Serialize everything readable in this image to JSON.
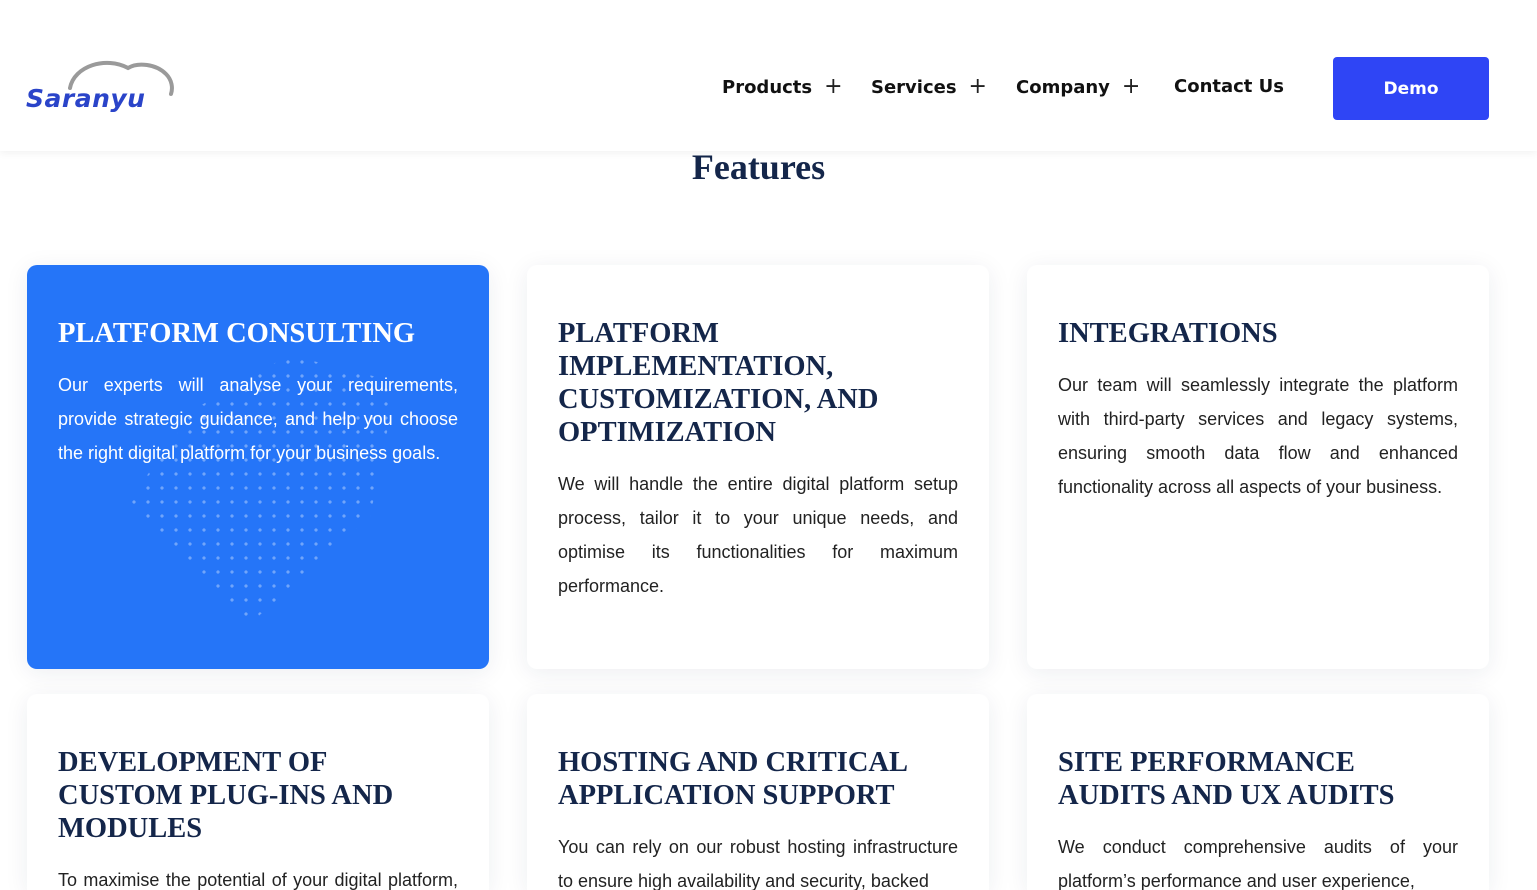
{
  "brand": {
    "name": "Saranyu",
    "accent": "#2f45f5",
    "card_active": "#2575f8",
    "heading_color": "#14264a"
  },
  "nav": {
    "items": [
      {
        "label": "Products",
        "has_submenu": true,
        "icon": "plus-icon"
      },
      {
        "label": "Services",
        "has_submenu": true,
        "icon": "plus-icon"
      },
      {
        "label": "Company",
        "has_submenu": true,
        "icon": "plus-icon"
      },
      {
        "label": "Contact Us",
        "has_submenu": false
      }
    ],
    "plus_glyph": "+",
    "demo_label": "Demo"
  },
  "features": {
    "title": "Features",
    "cards": [
      {
        "title": "PLATFORM CONSULTING",
        "text": "Our experts will analyse your requirements, provide strategic guidance, and help you choose the right digital platform for your business goals.",
        "active": true
      },
      {
        "title": "PLATFORM IMPLEMENTATION, CUSTOMIZATION, AND OPTIMIZATION",
        "text": "We will handle the entire digital platform setup process, tailor it to your unique needs, and optimise its functionalities for maximum performance.",
        "active": false
      },
      {
        "title": "INTEGRATIONS",
        "text": "Our team will seamlessly integrate the platform with third-party services and legacy systems, ensuring smooth data flow and enhanced functionality across all aspects of your business.",
        "active": false
      },
      {
        "title": "DEVELOPMENT OF CUSTOM PLUG-INS AND MODULES",
        "text": "To maximise the potential of your digital platform, we offer custom development services",
        "active": false
      },
      {
        "title": "HOSTING AND CRITICAL APPLICATION SUPPORT",
        "text": "You can rely on our robust hosting infrastructure to ensure high availability and security, backed",
        "active": false
      },
      {
        "title": "SITE PERFORMANCE AUDITS AND UX AUDITS",
        "text": "We conduct comprehensive audits of your platform’s performance and user experience,",
        "active": false
      }
    ]
  }
}
